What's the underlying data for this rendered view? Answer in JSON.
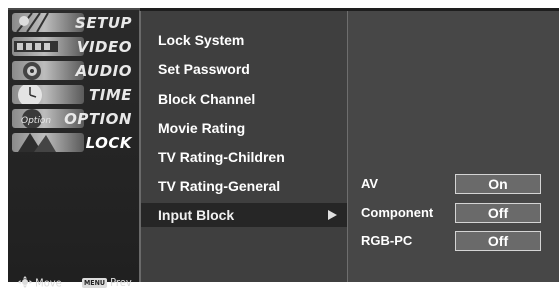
{
  "left_menu": {
    "items": [
      {
        "label": "SETUP",
        "icon": "setup-icon",
        "active": false
      },
      {
        "label": "VIDEO",
        "icon": "video-icon",
        "active": false
      },
      {
        "label": "AUDIO",
        "icon": "audio-icon",
        "active": false
      },
      {
        "label": "TIME",
        "icon": "time-icon",
        "active": false
      },
      {
        "label": "OPTION",
        "icon": "option-icon",
        "active": false
      },
      {
        "label": "LOCK",
        "icon": "lock-icon",
        "active": true
      }
    ],
    "hint_move": "Move",
    "hint_prev": "Prev",
    "hint_menu_key": "MENU",
    "hint_move_icon": "dpad-icon",
    "option_thumb_text": "Option"
  },
  "submenu": {
    "items": [
      {
        "label": "Lock System"
      },
      {
        "label": "Set Password"
      },
      {
        "label": "Block Channel"
      },
      {
        "label": "Movie Rating"
      },
      {
        "label": "TV Rating-Children"
      },
      {
        "label": "TV Rating-General"
      },
      {
        "label": "Input Block",
        "selected": true,
        "has_arrow": true
      }
    ]
  },
  "input_block": {
    "rows": [
      {
        "label": "AV",
        "value": "On"
      },
      {
        "label": "Component",
        "value": "Off"
      },
      {
        "label": "RGB-PC",
        "value": "Off"
      }
    ]
  },
  "colors": {
    "background": "#4a4a4a",
    "selected_row": "#262626",
    "value_box": "#6a6a6a"
  }
}
